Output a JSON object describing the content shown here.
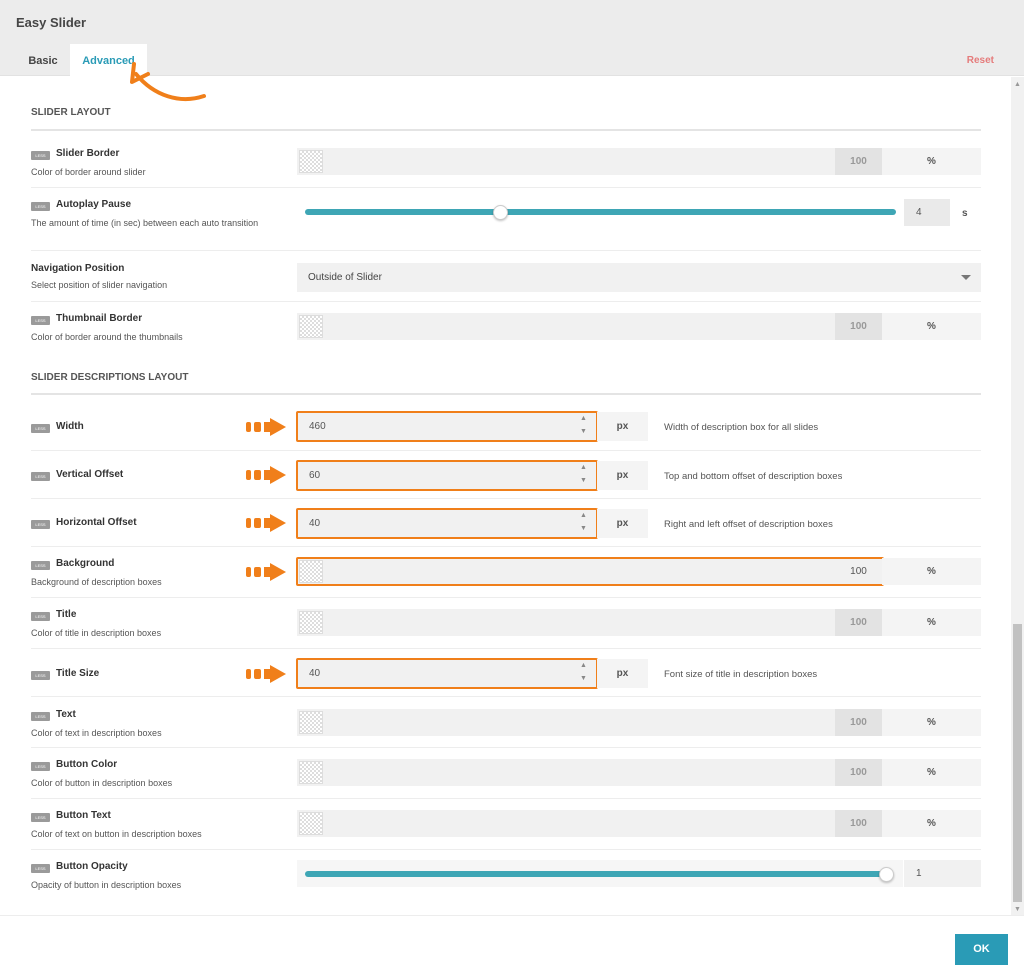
{
  "app": {
    "title": "Easy Slider"
  },
  "tabs": [
    {
      "label": "Basic"
    },
    {
      "label": "Advanced"
    }
  ],
  "reset_label": "Reset",
  "sections": {
    "slider_layout": {
      "title": "SLIDER LAYOUT",
      "slider_border": {
        "label": "Slider Border",
        "desc": "Color of border around slider",
        "opacity": "100",
        "unit": "%"
      },
      "autoplay_pause": {
        "label": "Autoplay Pause",
        "desc": "The amount of time (in sec) between each auto transition",
        "value": "4",
        "unit": "s",
        "level": 0.33
      },
      "navigation_position": {
        "label": "Navigation Position",
        "desc": "Select position of slider navigation",
        "selected": "Outside of Slider"
      },
      "thumbnail_border": {
        "label": "Thumbnail Border",
        "desc": "Color of border around the thumbnails",
        "opacity": "100",
        "unit": "%"
      }
    },
    "descriptions_layout": {
      "title": "SLIDER DESCRIPTIONS LAYOUT",
      "width": {
        "label": "Width",
        "value": "460",
        "unit": "px",
        "help": "Width of description box for all slides"
      },
      "vertical_offset": {
        "label": "Vertical Offset",
        "value": "60",
        "unit": "px",
        "help": "Top and bottom offset of description boxes"
      },
      "horizontal_offset": {
        "label": "Horizontal Offset",
        "value": "40",
        "unit": "px",
        "help": "Right and left offset of description boxes"
      },
      "background": {
        "label": "Background",
        "desc": "Background of description boxes",
        "opacity": "100",
        "unit": "%"
      },
      "title_color": {
        "label": "Title",
        "desc": "Color of title in description boxes",
        "opacity": "100",
        "unit": "%"
      },
      "title_size": {
        "label": "Title Size",
        "value": "40",
        "unit": "px",
        "help": "Font size of title in description boxes"
      },
      "text_color": {
        "label": "Text",
        "desc": "Color of text in description boxes",
        "opacity": "100",
        "unit": "%"
      },
      "button_color": {
        "label": "Button Color",
        "desc": "Color of button in description boxes",
        "opacity": "100",
        "unit": "%"
      },
      "button_text": {
        "label": "Button Text",
        "desc": "Color of text on button in description boxes",
        "opacity": "100",
        "unit": "%"
      },
      "button_opacity": {
        "label": "Button Opacity",
        "desc": "Opacity of button in description boxes",
        "value": "1",
        "level": 1.0
      }
    }
  },
  "footer": {
    "ok_label": "OK"
  },
  "colors": {
    "accent": "#2a9bb6",
    "slider": "#3ea6b5",
    "highlight": "#f07f1a",
    "reset": "#e57b7b"
  }
}
